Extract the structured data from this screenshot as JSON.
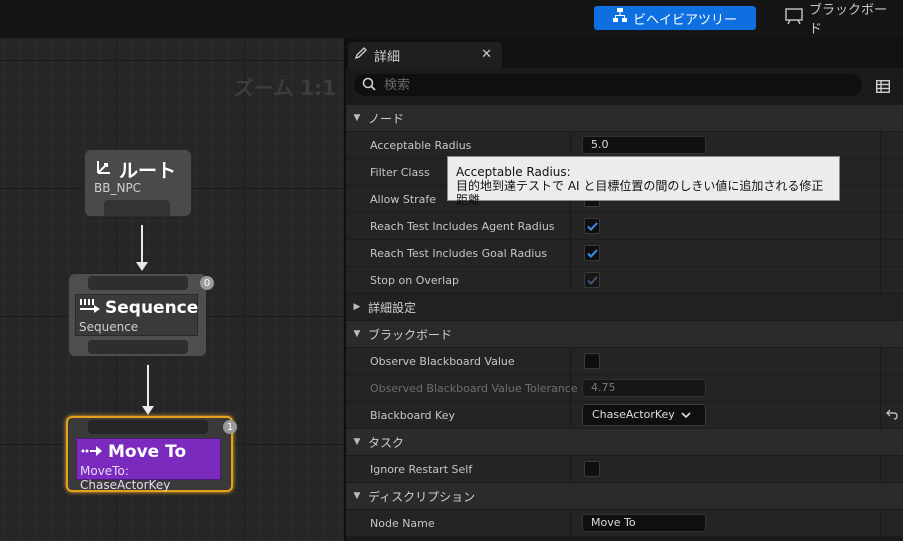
{
  "toolbar": {
    "behavior_tree_label": "ビヘイビアツリー",
    "blackboard_label": "ブラックボード"
  },
  "graph": {
    "zoom_label": "ズーム 1:1",
    "root": {
      "title": "ルート",
      "subtitle": "BB_NPC"
    },
    "sequence": {
      "title": "Sequence",
      "subtitle": "Sequence",
      "index": "0"
    },
    "move_to": {
      "title": "Move To",
      "subtitle": "MoveTo: ChaseActorKey",
      "index": "1",
      "selected": true
    }
  },
  "details": {
    "tab_title": "詳細",
    "search_placeholder": "検索",
    "sections": {
      "node": "ノード",
      "advanced": "詳細設定",
      "blackboard": "ブラックボード",
      "task": "タスク",
      "description": "ディスクリプション"
    },
    "props": {
      "acceptable_radius": {
        "label": "Acceptable Radius",
        "value": "5.0"
      },
      "filter_class": {
        "label": "Filter Class"
      },
      "allow_strafe": {
        "label": "Allow Strafe"
      },
      "reach_agent_radius": {
        "label": "Reach Test Includes Agent Radius",
        "checked": true
      },
      "reach_goal_radius": {
        "label": "Reach Test Includes Goal Radius",
        "checked": true
      },
      "stop_on_overlap": {
        "label": "Stop on Overlap",
        "checked": true,
        "disabled": true
      },
      "observe_bb_value": {
        "label": "Observe Blackboard Value",
        "checked": false
      },
      "observed_tolerance": {
        "label": "Observed Blackboard Value Tolerance",
        "value": "4.75",
        "disabled": true
      },
      "blackboard_key": {
        "label": "Blackboard Key",
        "value": "ChaseActorKey"
      },
      "ignore_restart_self": {
        "label": "Ignore Restart Self",
        "checked": false
      },
      "node_name": {
        "label": "Node Name",
        "value": "Move To"
      }
    }
  },
  "tooltip": {
    "title": "Acceptable Radius:",
    "body": "目的地到達テストで AI と目標位置の間のしきい値に追加される修正距離"
  },
  "colors": {
    "accent_blue": "#0e6fe0",
    "move_to_purple": "#7a2bbd",
    "selection_orange": "#e5a11c",
    "checkmark_blue": "#3a8ee6"
  }
}
